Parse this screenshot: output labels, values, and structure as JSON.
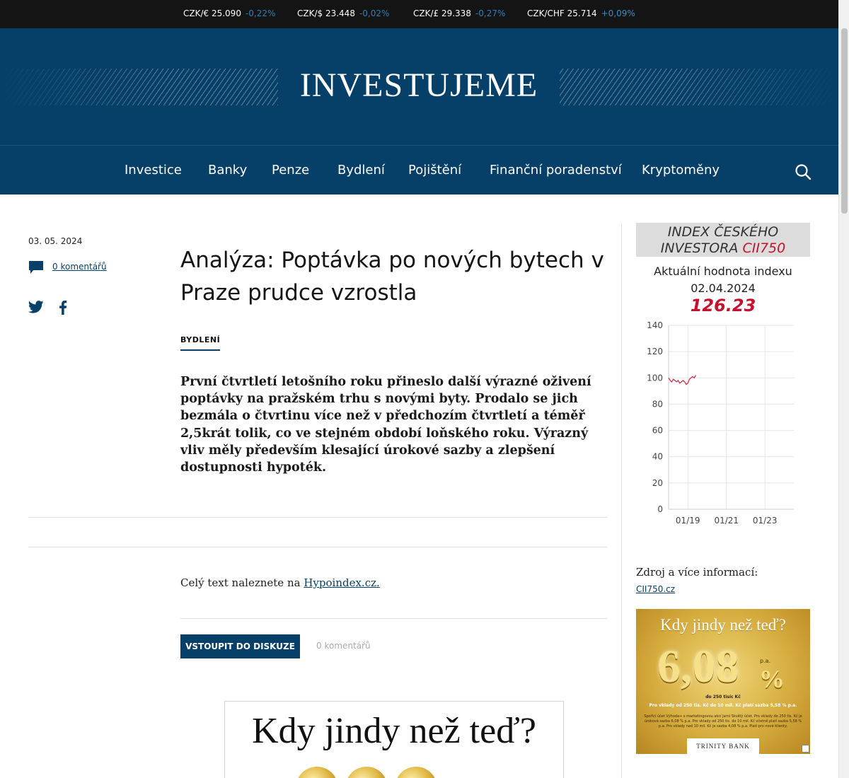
{
  "ticker": [
    {
      "pair": "CZK/€ 25.090",
      "change": "-0,22%"
    },
    {
      "pair": "CZK/$ 23.448",
      "change": "-0,02%"
    },
    {
      "pair": "CZK/£ 29.338",
      "change": "-0,27%"
    },
    {
      "pair": "CZK/CHF 25.714",
      "change": "+0,09%"
    }
  ],
  "header": {
    "logo": "INVESTUJEME"
  },
  "nav": {
    "items": [
      "Investice",
      "Banky",
      "Penze",
      "Bydlení",
      "Pojištění",
      "Finanční poradenství",
      "Kryptoměny"
    ],
    "search_icon": "search-icon"
  },
  "article": {
    "date": "03. 05. 2024",
    "comments_link": "0 komentářů",
    "share_icons": [
      "twitter-icon",
      "facebook-icon"
    ],
    "title": "Analýza: Poptávka po nových bytech v Praze prudce vzrostla",
    "category": "BYDLENÍ",
    "perex": "První čtvrtletí letošního roku přineslo další výrazné oživení poptávky na pražském trhu s novými byty. Prodalo se jich bezmála o čtvrtinu více než v předchozím čtvrtletí a téměř 2,5krát tolik, co ve stejném období loňského roku. Výrazný vliv měly především klesající úrokové sazby a zlepšení dostupnosti hypoték.",
    "fulltext_prefix": "Celý text naleznete na",
    "fulltext_link": "Hypoindex.cz.",
    "discuss_button": "VSTOUPIT DO DISKUZE",
    "discuss_count": "0 komentářů"
  },
  "banner_main": {
    "headline": "Kdy jindy než teď?"
  },
  "widget": {
    "title_line1": "INDEX ČESKÉHO",
    "title_line2": "INVESTORA",
    "title_brand": "CII750",
    "subtitle_line1": "Aktuální hodnota indexu",
    "subtitle_line2": "02.04.2024",
    "value": "126.23",
    "source_label": "Zdroj a více informací:",
    "source_link": "CII750.cz"
  },
  "chart_data": {
    "type": "line",
    "title": "",
    "xlabel": "",
    "ylabel": "",
    "ylim": [
      0,
      140
    ],
    "yticks": [
      0,
      20,
      40,
      60,
      80,
      100,
      120,
      140
    ],
    "xticks": [
      "01/19",
      "01/21",
      "01/23"
    ],
    "grid": true,
    "color": "#d4213d",
    "series": [
      {
        "x": [
          "2018-01",
          "2018-02",
          "2018-03",
          "2018-04",
          "2018-05",
          "2018-06",
          "2018-07",
          "2018-08",
          "2018-09",
          "2018-10",
          "2018-11",
          "2018-12",
          "2019-01",
          "2019-02",
          "2019-03",
          "2019-04",
          "2019-05",
          "2019-06"
        ],
        "values": [
          100,
          98,
          97,
          99,
          98,
          97,
          98,
          96,
          97,
          98,
          97,
          95,
          96,
          99,
          100,
          101,
          100,
          102
        ]
      }
    ]
  },
  "banner_side": {
    "headline": "Kdy jindy než teď?",
    "rate": "6,08",
    "percent": "%",
    "pa": "p.a.",
    "upto": "do 250 tisíc Kč",
    "line1": "Pro vklady od 250 tis. Kč do 10 mil. Kč platí sazba 5,58 % p.a.",
    "fine": "Spořicí účet Výhoda+ s marketingovou akcí Jarní Skvělý účet. Pro vklady do 250 tis. Kč je úroková sazba 6,08 % p.a. Pro vklady od 250 tis. do 10 mil. Kč včetně platí sazba 5,58 % p.a. Pro vklady nad 10 mil. Kč je sazba 4,08 % p.a. Platí pro nové klienty.",
    "brand": "TRINITY BANK"
  },
  "colors": {
    "brand": "#064069",
    "accent": "#c8102e",
    "ticker_bg": "#141414"
  }
}
